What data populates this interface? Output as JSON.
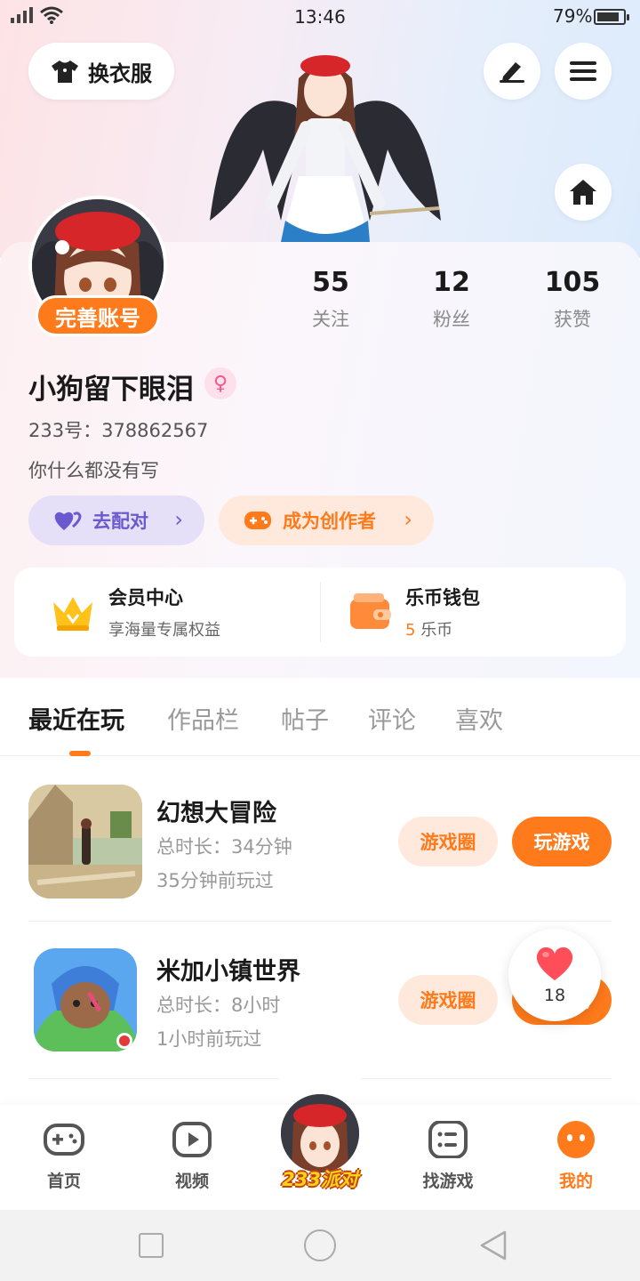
{
  "status_bar": {
    "time": "13:46",
    "battery": "79%"
  },
  "header": {
    "change_clothes_label": "换衣服"
  },
  "profile": {
    "avatar_badge": "完善账号",
    "username": "小狗留下眼泪",
    "gender_symbol": "♀",
    "uid": "233号：378862567",
    "bio": "你什么都没有写",
    "stats": [
      {
        "value": "55",
        "label": "关注"
      },
      {
        "value": "12",
        "label": "粉丝"
      },
      {
        "value": "105",
        "label": "获赞"
      }
    ],
    "chips": {
      "match": "去配对",
      "creator": "成为创作者"
    }
  },
  "wallet": {
    "vip_title": "会员中心",
    "vip_sub": "享海量专属权益",
    "coin_title": "乐币钱包",
    "coin_amount": "5",
    "coin_unit": "乐币"
  },
  "tabs": [
    "最近在玩",
    "作品栏",
    "帖子",
    "评论",
    "喜欢"
  ],
  "games": [
    {
      "name": "幻想大冒险",
      "duration": "总时长：34分钟",
      "last_played": "35分钟前玩过",
      "circle_btn": "游戏圈",
      "play_btn": "玩游戏"
    },
    {
      "name": "米加小镇世界",
      "duration": "总时长：8小时",
      "last_played": "1小时前玩过",
      "circle_btn": "游戏圈",
      "play_btn": "玩游戏"
    }
  ],
  "like_float": {
    "count": "18"
  },
  "bottom_nav": {
    "items": [
      "首页",
      "视频",
      "找游戏",
      "我的"
    ],
    "center_label": "233派对"
  },
  "colors": {
    "accent": "#ff7a1a",
    "match_chip": "#6a5acd"
  }
}
